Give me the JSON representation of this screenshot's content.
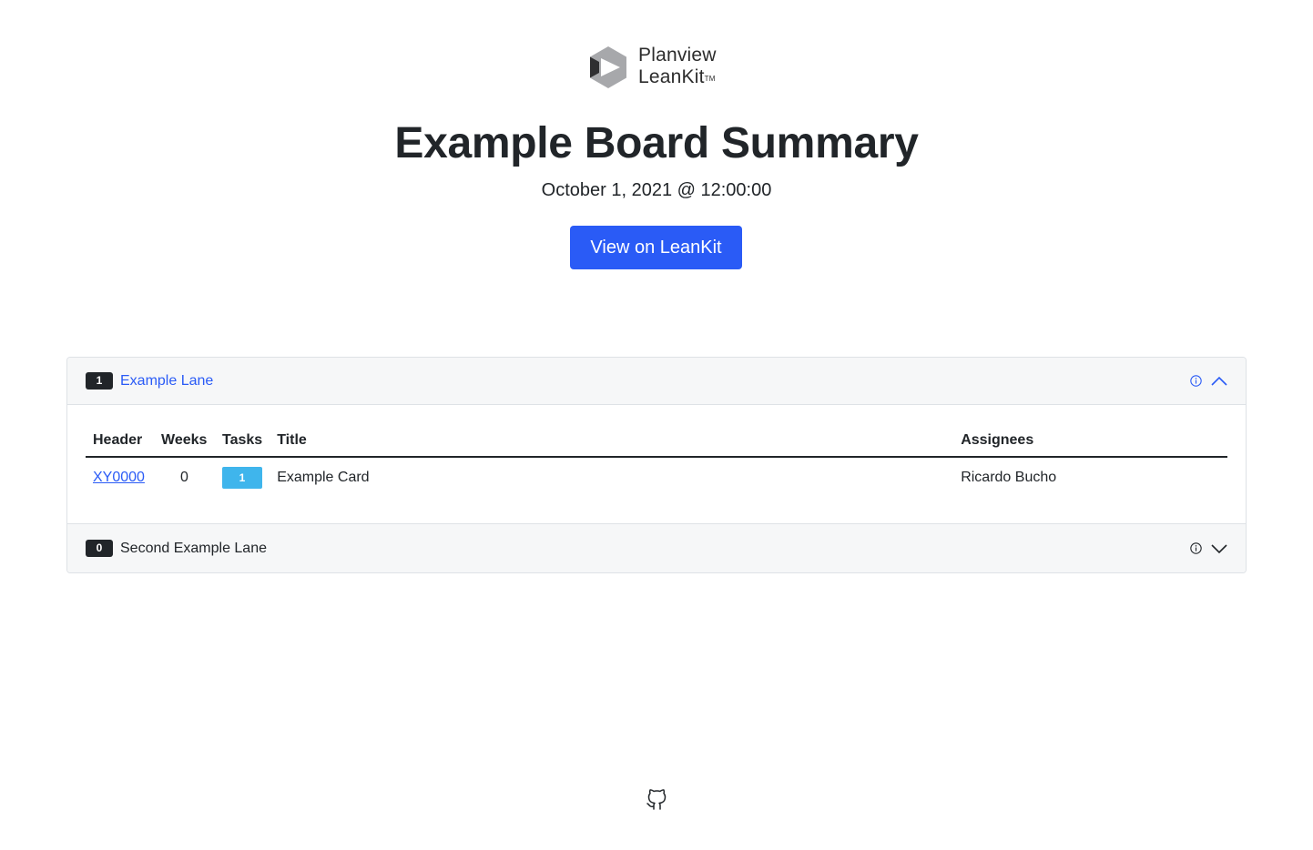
{
  "brand": {
    "line1": "Planview",
    "line2": "LeanKit",
    "tm": "TM"
  },
  "page": {
    "title": "Example Board Summary",
    "date": "October 1, 2021 @ 12:00:00",
    "view_button": "View on LeanKit"
  },
  "colors": {
    "accent": "#2a5bf6",
    "badge_dark": "#212529",
    "task_badge": "#3fb5ec",
    "header_bg": "#f6f7f8"
  },
  "lanes": [
    {
      "count": "1",
      "name": "Example Lane",
      "expanded": true,
      "columns": [
        "Header",
        "Weeks",
        "Tasks",
        "Title",
        "Assignees"
      ],
      "rows": [
        {
          "header": "XY0000",
          "weeks": "0",
          "tasks": "1",
          "title": "Example Card",
          "assignees": "Ricardo Bucho"
        }
      ]
    },
    {
      "count": "0",
      "name": "Second Example Lane",
      "expanded": false
    }
  ],
  "icons": {
    "info": "info-icon",
    "collapse": "chevron-up-icon",
    "expand": "chevron-down-icon",
    "footer": "github-icon"
  }
}
